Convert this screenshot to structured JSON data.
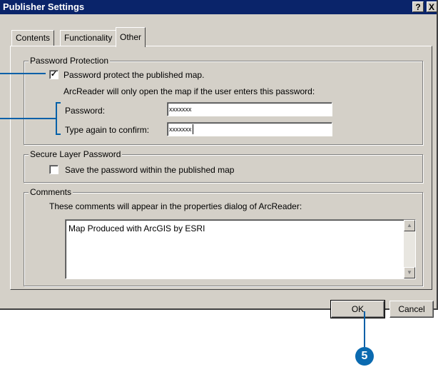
{
  "window": {
    "title": "Publisher Settings",
    "help_glyph": "?",
    "close_glyph": "X"
  },
  "tabs": [
    {
      "label": "Contents",
      "active": false
    },
    {
      "label": "Functionality",
      "active": false
    },
    {
      "label": "Other",
      "active": true
    }
  ],
  "password_protection": {
    "group_title": "Password Protection",
    "checkbox_label": "Password protect the published map.",
    "checked": true,
    "info_text": "ArcReader will only open the map if the user enters this password:",
    "password_label": "Password:",
    "password_value": "xxxxxxx",
    "confirm_label": "Type again to confirm:",
    "confirm_value": "xxxxxxx"
  },
  "secure_layer": {
    "group_title": "Secure Layer Password",
    "checkbox_label": "Save the password within the published map",
    "checked": false
  },
  "comments": {
    "group_title": "Comments",
    "info_text": "These comments will appear in the properties dialog of ArcReader:",
    "value": "Map Produced with ArcGIS by ESRI"
  },
  "buttons": {
    "ok": "OK",
    "cancel": "Cancel"
  },
  "annotation": {
    "step_number": "5",
    "check_glyph": "✓",
    "scroll_up": "▲",
    "scroll_down": "▼",
    "callout_color": "#0060a8"
  }
}
